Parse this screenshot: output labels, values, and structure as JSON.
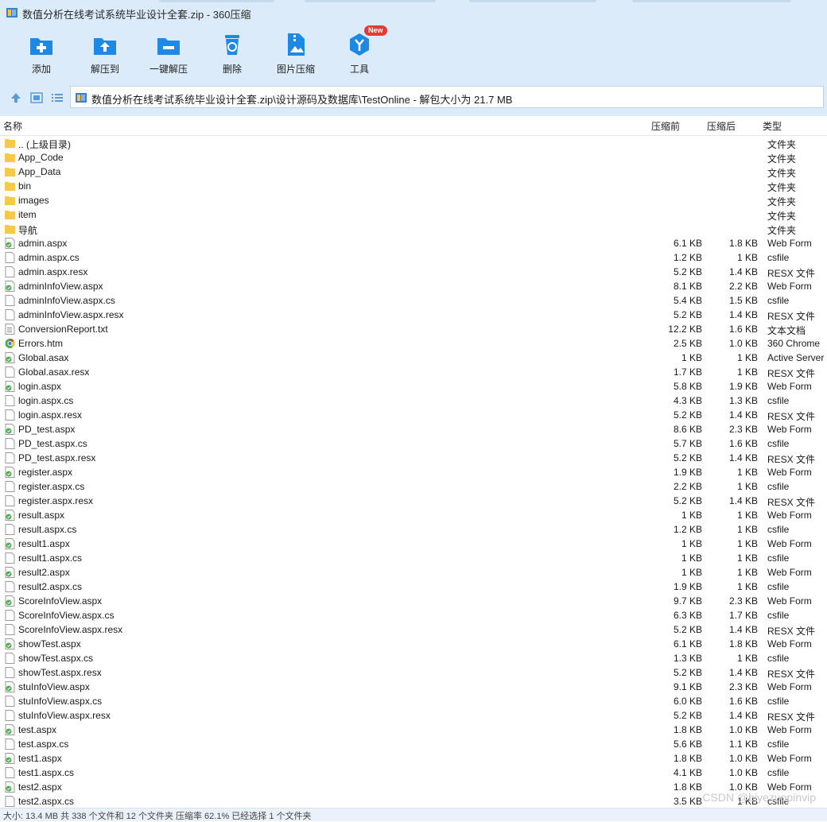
{
  "window": {
    "title": "数值分析在线考试系统毕业设计全套.zip - 360压缩"
  },
  "toolbar": {
    "items": [
      {
        "label": "添加",
        "icon": "add-icon"
      },
      {
        "label": "解压到",
        "icon": "extract-to-icon"
      },
      {
        "label": "一键解压",
        "icon": "one-click-extract-icon"
      },
      {
        "label": "删除",
        "icon": "delete-icon"
      },
      {
        "label": "图片压缩",
        "icon": "image-compress-icon"
      },
      {
        "label": "工具",
        "icon": "tools-icon",
        "badge": "New"
      }
    ]
  },
  "address": {
    "path": "数值分析在线考试系统毕业设计全套.zip\\设计源码及数据库\\TestOnline - 解包大小为 21.7 MB"
  },
  "columns": {
    "name": "名称",
    "size": "压缩前",
    "compressed": "压缩后",
    "type": "类型"
  },
  "files": [
    {
      "name": ".. (上级目录)",
      "size": "",
      "compressed": "",
      "type": "文件夹",
      "icon": "folder"
    },
    {
      "name": "App_Code",
      "size": "",
      "compressed": "",
      "type": "文件夹",
      "icon": "folder"
    },
    {
      "name": "App_Data",
      "size": "",
      "compressed": "",
      "type": "文件夹",
      "icon": "folder"
    },
    {
      "name": "bin",
      "size": "",
      "compressed": "",
      "type": "文件夹",
      "icon": "folder"
    },
    {
      "name": "images",
      "size": "",
      "compressed": "",
      "type": "文件夹",
      "icon": "folder"
    },
    {
      "name": "item",
      "size": "",
      "compressed": "",
      "type": "文件夹",
      "icon": "folder"
    },
    {
      "name": "导航",
      "size": "",
      "compressed": "",
      "type": "文件夹",
      "icon": "folder"
    },
    {
      "name": "admin.aspx",
      "size": "6.1 KB",
      "compressed": "1.8 KB",
      "type": "Web Form",
      "icon": "aspx"
    },
    {
      "name": "admin.aspx.cs",
      "size": "1.2 KB",
      "compressed": "1 KB",
      "type": "csfile",
      "icon": "file"
    },
    {
      "name": "admin.aspx.resx",
      "size": "5.2 KB",
      "compressed": "1.4 KB",
      "type": "RESX 文件",
      "icon": "file"
    },
    {
      "name": "adminInfoView.aspx",
      "size": "8.1 KB",
      "compressed": "2.2 KB",
      "type": "Web Form",
      "icon": "aspx"
    },
    {
      "name": "adminInfoView.aspx.cs",
      "size": "5.4 KB",
      "compressed": "1.5 KB",
      "type": "csfile",
      "icon": "file"
    },
    {
      "name": "adminInfoView.aspx.resx",
      "size": "5.2 KB",
      "compressed": "1.4 KB",
      "type": "RESX 文件",
      "icon": "file"
    },
    {
      "name": "ConversionReport.txt",
      "size": "12.2 KB",
      "compressed": "1.6 KB",
      "type": "文本文档",
      "icon": "txt"
    },
    {
      "name": "Errors.htm",
      "size": "2.5 KB",
      "compressed": "1.0 KB",
      "type": "360 Chrome",
      "icon": "htm"
    },
    {
      "name": "Global.asax",
      "size": "1 KB",
      "compressed": "1 KB",
      "type": "Active Server",
      "icon": "aspx"
    },
    {
      "name": "Global.asax.resx",
      "size": "1.7 KB",
      "compressed": "1 KB",
      "type": "RESX 文件",
      "icon": "file"
    },
    {
      "name": "login.aspx",
      "size": "5.8 KB",
      "compressed": "1.9 KB",
      "type": "Web Form",
      "icon": "aspx"
    },
    {
      "name": "login.aspx.cs",
      "size": "4.3 KB",
      "compressed": "1.3 KB",
      "type": "csfile",
      "icon": "file"
    },
    {
      "name": "login.aspx.resx",
      "size": "5.2 KB",
      "compressed": "1.4 KB",
      "type": "RESX 文件",
      "icon": "file"
    },
    {
      "name": "PD_test.aspx",
      "size": "8.6 KB",
      "compressed": "2.3 KB",
      "type": "Web Form",
      "icon": "aspx"
    },
    {
      "name": "PD_test.aspx.cs",
      "size": "5.7 KB",
      "compressed": "1.6 KB",
      "type": "csfile",
      "icon": "file"
    },
    {
      "name": "PD_test.aspx.resx",
      "size": "5.2 KB",
      "compressed": "1.4 KB",
      "type": "RESX 文件",
      "icon": "file"
    },
    {
      "name": "register.aspx",
      "size": "1.9 KB",
      "compressed": "1 KB",
      "type": "Web Form",
      "icon": "aspx"
    },
    {
      "name": "register.aspx.cs",
      "size": "2.2 KB",
      "compressed": "1 KB",
      "type": "csfile",
      "icon": "file"
    },
    {
      "name": "register.aspx.resx",
      "size": "5.2 KB",
      "compressed": "1.4 KB",
      "type": "RESX 文件",
      "icon": "file"
    },
    {
      "name": "result.aspx",
      "size": "1 KB",
      "compressed": "1 KB",
      "type": "Web Form",
      "icon": "aspx"
    },
    {
      "name": "result.aspx.cs",
      "size": "1.2 KB",
      "compressed": "1 KB",
      "type": "csfile",
      "icon": "file"
    },
    {
      "name": "result1.aspx",
      "size": "1 KB",
      "compressed": "1 KB",
      "type": "Web Form",
      "icon": "aspx"
    },
    {
      "name": "result1.aspx.cs",
      "size": "1 KB",
      "compressed": "1 KB",
      "type": "csfile",
      "icon": "file"
    },
    {
      "name": "result2.aspx",
      "size": "1 KB",
      "compressed": "1 KB",
      "type": "Web Form",
      "icon": "aspx"
    },
    {
      "name": "result2.aspx.cs",
      "size": "1.9 KB",
      "compressed": "1 KB",
      "type": "csfile",
      "icon": "file"
    },
    {
      "name": "ScoreInfoView.aspx",
      "size": "9.7 KB",
      "compressed": "2.3 KB",
      "type": "Web Form",
      "icon": "aspx"
    },
    {
      "name": "ScoreInfoView.aspx.cs",
      "size": "6.3 KB",
      "compressed": "1.7 KB",
      "type": "csfile",
      "icon": "file"
    },
    {
      "name": "ScoreInfoView.aspx.resx",
      "size": "5.2 KB",
      "compressed": "1.4 KB",
      "type": "RESX 文件",
      "icon": "file"
    },
    {
      "name": "showTest.aspx",
      "size": "6.1 KB",
      "compressed": "1.8 KB",
      "type": "Web Form",
      "icon": "aspx"
    },
    {
      "name": "showTest.aspx.cs",
      "size": "1.3 KB",
      "compressed": "1 KB",
      "type": "csfile",
      "icon": "file"
    },
    {
      "name": "showTest.aspx.resx",
      "size": "5.2 KB",
      "compressed": "1.4 KB",
      "type": "RESX 文件",
      "icon": "file"
    },
    {
      "name": "stuInfoView.aspx",
      "size": "9.1 KB",
      "compressed": "2.3 KB",
      "type": "Web Form",
      "icon": "aspx"
    },
    {
      "name": "stuInfoView.aspx.cs",
      "size": "6.0 KB",
      "compressed": "1.6 KB",
      "type": "csfile",
      "icon": "file"
    },
    {
      "name": "stuInfoView.aspx.resx",
      "size": "5.2 KB",
      "compressed": "1.4 KB",
      "type": "RESX 文件",
      "icon": "file"
    },
    {
      "name": "test.aspx",
      "size": "1.8 KB",
      "compressed": "1.0 KB",
      "type": "Web Form",
      "icon": "aspx"
    },
    {
      "name": "test.aspx.cs",
      "size": "5.6 KB",
      "compressed": "1.1 KB",
      "type": "csfile",
      "icon": "file"
    },
    {
      "name": "test1.aspx",
      "size": "1.8 KB",
      "compressed": "1.0 KB",
      "type": "Web Form",
      "icon": "aspx"
    },
    {
      "name": "test1.aspx.cs",
      "size": "4.1 KB",
      "compressed": "1.0 KB",
      "type": "csfile",
      "icon": "file"
    },
    {
      "name": "test2.aspx",
      "size": "1.8 KB",
      "compressed": "1.0 KB",
      "type": "Web Form",
      "icon": "aspx"
    },
    {
      "name": "test2.aspx.cs",
      "size": "3.5 KB",
      "compressed": "1 KB",
      "type": "csfile",
      "icon": "file"
    }
  ],
  "status": {
    "text": "大小: 13.4 MB 共 338 个文件和 12 个文件夹 压缩率 62.1% 已经选择 1 个文件夹",
    "watermark": "CSDN @biyezuopinvip"
  },
  "colors": {
    "chrome": "#dcebfa",
    "accent": "#1e88e5",
    "folder": "#f7c948"
  }
}
